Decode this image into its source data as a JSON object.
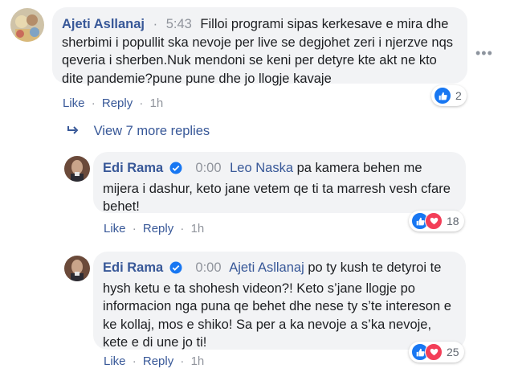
{
  "comment": {
    "author": "Ajeti Asllanaj",
    "separator": "·",
    "time": "5:43",
    "text": "Filloi programi sipas kerkesave e mira dhe sherbimi i popullit ska nevoje per live se degjohet zeri i njerzve nqs qeveria i sherben.Nuk mendoni se keni per detyre kte akt ne kto dite pandemie?pune pune dhe jo llogje kavaje",
    "actions": {
      "like": "Like",
      "reply": "Reply",
      "age": "1h",
      "dot": "·"
    },
    "reactions": {
      "count": "2",
      "icons": [
        "like-icon"
      ]
    },
    "more_icon": "ellipsis-icon",
    "more_glyph": "•••"
  },
  "view_more": {
    "label": "View 7 more replies",
    "icon": "reply-arrow-icon",
    "glyph": "↳"
  },
  "replies": [
    {
      "author": "Edi Rama",
      "verified": true,
      "time": "0:00",
      "mention": "Leo Naska",
      "text": "pa kamera behen me mijera i dashur, keto jane vetem qe ti ta marresh vesh cfare behet!",
      "actions": {
        "like": "Like",
        "reply": "Reply",
        "age": "1h",
        "dot": "·"
      },
      "reactions": {
        "count": "18",
        "icons": [
          "like-icon",
          "love-icon"
        ]
      }
    },
    {
      "author": "Edi Rama",
      "verified": true,
      "time": "0:00",
      "mention": "Ajeti Asllanaj",
      "text": "po ty kush te detyroi te hysh ketu e ta shohesh videon?! Keto s’jane llogje po informacion nga puna qe behet dhe nese ty s’te intereson e ke kollaj, mos e shiko! Sa per a ka nevoje a s’ka nevoje, kete e di une jo ti!",
      "actions": {
        "like": "Like",
        "reply": "Reply",
        "age": "1h",
        "dot": "·"
      },
      "reactions": {
        "count": "25",
        "icons": [
          "like-icon",
          "love-icon"
        ]
      }
    }
  ],
  "colors": {
    "link": "#385898",
    "bubble": "#f2f3f5",
    "muted": "#90949c",
    "like": "#1877f2",
    "love": "#f33e58"
  }
}
